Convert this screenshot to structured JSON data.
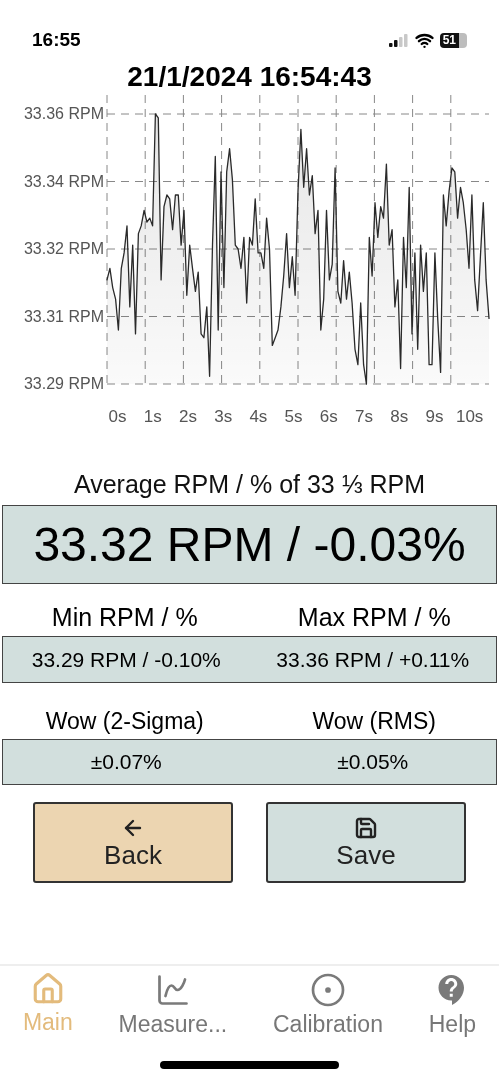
{
  "status_bar": {
    "time": "16:55",
    "battery": "51"
  },
  "title": "21/1/2024 16:54:43",
  "chart": {
    "chart_data": {
      "type": "line",
      "grid": true,
      "xlim": [
        -0.3,
        10.55
      ],
      "ylim": [
        33.29,
        33.36
      ],
      "x": [
        -0.3,
        -0.219,
        -0.138,
        -0.057,
        0.024,
        0.105,
        0.186,
        0.267,
        0.348,
        0.429,
        0.51,
        0.591,
        0.672,
        0.753,
        0.834,
        0.915,
        0.996,
        1.076,
        1.157,
        1.238,
        1.319,
        1.4,
        1.481,
        1.562,
        1.643,
        1.724,
        1.805,
        1.886,
        1.967,
        2.048,
        2.129,
        2.21,
        2.291,
        2.372,
        2.453,
        2.534,
        2.615,
        2.696,
        2.777,
        2.858,
        2.939,
        3.02,
        3.101,
        3.182,
        3.263,
        3.344,
        3.425,
        3.506,
        3.587,
        3.668,
        3.749,
        3.829,
        3.91,
        3.991,
        4.072,
        4.153,
        4.234,
        4.315,
        4.396,
        4.477,
        4.558,
        4.639,
        4.72,
        4.801,
        4.882,
        4.963,
        5.044,
        5.125,
        5.206,
        5.287,
        5.368,
        5.449,
        5.53,
        5.611,
        5.692,
        5.773,
        5.854,
        5.935,
        6.016,
        6.097,
        6.178,
        6.259,
        6.34,
        6.421,
        6.502,
        6.582,
        6.663,
        6.744,
        6.825,
        6.906,
        6.987,
        7.068,
        7.149,
        7.23,
        7.311,
        7.392,
        7.473,
        7.554,
        7.635,
        7.716,
        7.797,
        7.878,
        7.959,
        8.04,
        8.121,
        8.202,
        8.283,
        8.364,
        8.445,
        8.526,
        8.607,
        8.688,
        8.769,
        8.85,
        8.931,
        9.012,
        9.093,
        9.174,
        9.255,
        9.335,
        9.416,
        9.497,
        9.578,
        9.659,
        9.74,
        9.821,
        9.902,
        9.983,
        10.064,
        10.145,
        10.226,
        10.307,
        10.388,
        10.469,
        10.55
      ],
      "xticks": [
        {
          "value": 0,
          "label": "0s"
        },
        {
          "value": 1,
          "label": "1s"
        },
        {
          "value": 2,
          "label": "2s"
        },
        {
          "value": 3,
          "label": "3s"
        },
        {
          "value": 4,
          "label": "4s"
        },
        {
          "value": 5,
          "label": "5s"
        },
        {
          "value": 6,
          "label": "6s"
        },
        {
          "value": 7,
          "label": "7s"
        },
        {
          "value": 8,
          "label": "8s"
        },
        {
          "value": 9,
          "label": "9s"
        },
        {
          "value": 10,
          "label": "10s"
        }
      ],
      "yticks": [
        {
          "value": 33.36,
          "label": "33.36 RPM"
        },
        {
          "value": 33.3425,
          "label": "33.34 RPM"
        },
        {
          "value": 33.325,
          "label": "33.32 RPM"
        },
        {
          "value": 33.3075,
          "label": "33.31 RPM"
        },
        {
          "value": 33.29,
          "label": "33.29 RPM"
        }
      ],
      "series": [
        {
          "color": "#2a2a2a",
          "values": [
            33.317,
            33.32,
            33.315,
            33.312,
            33.304,
            33.32,
            33.324,
            33.331,
            33.31,
            33.326,
            33.303,
            33.329,
            33.331,
            33.335,
            33.332,
            33.333,
            33.331,
            33.36,
            33.359,
            33.317,
            33.336,
            33.339,
            33.338,
            33.33,
            33.339,
            33.339,
            33.326,
            33.335,
            33.313,
            33.326,
            33.32,
            33.314,
            33.319,
            33.303,
            33.302,
            33.31,
            33.292,
            33.326,
            33.349,
            33.304,
            33.345,
            33.315,
            33.345,
            33.351,
            33.343,
            33.326,
            33.325,
            33.32,
            33.328,
            33.311,
            33.328,
            33.326,
            33.338,
            33.324,
            33.324,
            33.32,
            33.333,
            33.325,
            33.3,
            33.302,
            33.304,
            33.31,
            33.318,
            33.329,
            33.315,
            33.323,
            33.313,
            33.34,
            33.356,
            33.341,
            33.351,
            33.339,
            33.344,
            33.329,
            33.335,
            33.304,
            33.312,
            33.335,
            33.317,
            33.321,
            33.346,
            33.314,
            33.311,
            33.322,
            33.312,
            33.319,
            33.311,
            33.299,
            33.295,
            33.311,
            33.295,
            33.29,
            33.328,
            33.318,
            33.337,
            33.328,
            33.336,
            33.333,
            33.347,
            33.326,
            33.33,
            33.31,
            33.317,
            33.294,
            33.328,
            33.315,
            33.341,
            33.303,
            33.324,
            33.299,
            33.326,
            33.314,
            33.324,
            33.295,
            33.295,
            33.324,
            33.307,
            33.293,
            33.339,
            33.331,
            33.34,
            33.346,
            33.345,
            33.333,
            33.341,
            33.337,
            33.33,
            33.32,
            33.339,
            33.317,
            33.309,
            33.323,
            33.337,
            33.317,
            33.307
          ]
        }
      ]
    }
  },
  "average": {
    "label": "Average RPM / % of 33 ⅓ RPM",
    "value": "33.32 RPM / -0.03%"
  },
  "min_max": [
    {
      "label": "Min RPM / %",
      "value": "33.29 RPM / -0.10%"
    },
    {
      "label": "Max RPM / %",
      "value": "33.36 RPM / +0.11%"
    }
  ],
  "wow": [
    {
      "label": "Wow (2-Sigma)",
      "value": "±0.07%"
    },
    {
      "label": "Wow (RMS)",
      "value": "±0.05%"
    }
  ],
  "buttons": [
    {
      "kind": "back",
      "label": "Back"
    },
    {
      "kind": "save",
      "label": "Save"
    }
  ],
  "tabs": [
    {
      "kind": "home",
      "label": "Main",
      "selected": true
    },
    {
      "kind": "chart",
      "label": "Measure...",
      "selected": false
    },
    {
      "kind": "target",
      "label": "Calibration",
      "selected": false
    },
    {
      "kind": "help",
      "label": "Help",
      "selected": false
    }
  ]
}
